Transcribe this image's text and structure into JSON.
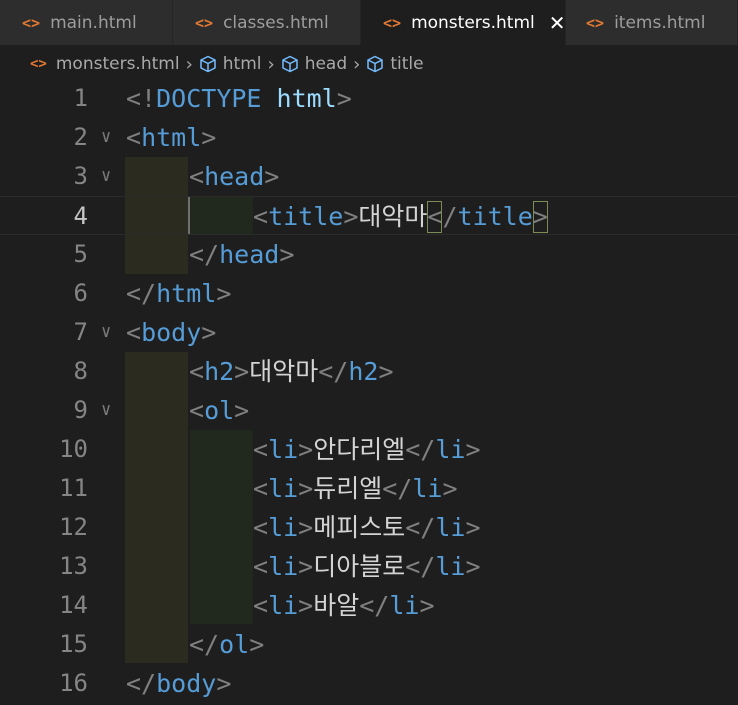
{
  "tabs": [
    {
      "label": "main.html",
      "active": false
    },
    {
      "label": "classes.html",
      "active": false
    },
    {
      "label": "monsters.html",
      "active": true,
      "close": "✕"
    },
    {
      "label": "items.html",
      "active": false
    }
  ],
  "breadcrumb": {
    "file": "monsters.html",
    "path": [
      "html",
      "head",
      "title"
    ]
  },
  "lines": [
    {
      "num": "1",
      "text": "<!DOCTYPE html>"
    },
    {
      "num": "2",
      "text": "<html>"
    },
    {
      "num": "3",
      "text": "<head>"
    },
    {
      "num": "4",
      "text": "<title>대악마</title>"
    },
    {
      "num": "5",
      "text": "</head>"
    },
    {
      "num": "6",
      "text": "</html>"
    },
    {
      "num": "7",
      "text": "<body>"
    },
    {
      "num": "8",
      "text": "<h2>대악마</h2>"
    },
    {
      "num": "9",
      "text": "<ol>"
    },
    {
      "num": "10",
      "text": "<li>안다리엘</li>"
    },
    {
      "num": "11",
      "text": "<li>듀리엘</li>"
    },
    {
      "num": "12",
      "text": "<li>메피스토</li>"
    },
    {
      "num": "13",
      "text": "<li>디아블로</li>"
    },
    {
      "num": "14",
      "text": "<li>바알</li>"
    },
    {
      "num": "15",
      "text": "</ol>"
    },
    {
      "num": "16",
      "text": "</body>"
    }
  ],
  "code": {
    "doctype_open": "<!",
    "doctype_kw": "DOCTYPE",
    "doctype_name": "html",
    "gt": ">",
    "lt": "<",
    "lts": "</",
    "tag_html": "html",
    "tag_head": "head",
    "tag_title": "title",
    "tag_body": "body",
    "tag_h2": "h2",
    "tag_ol": "ol",
    "tag_li": "li",
    "title_text": "대악마",
    "h2_text": "대악마",
    "items": [
      "안다리엘",
      "듀리엘",
      "메피스토",
      "디아블로",
      "바알"
    ]
  },
  "colors": {
    "tag": "#569cd6",
    "bracket": "#808080",
    "file_icon": "#e37933"
  },
  "icons": {
    "file": "html-file-icon",
    "symbol": "cube-icon",
    "fold": "chevron-down-icon",
    "close": "close-icon"
  }
}
